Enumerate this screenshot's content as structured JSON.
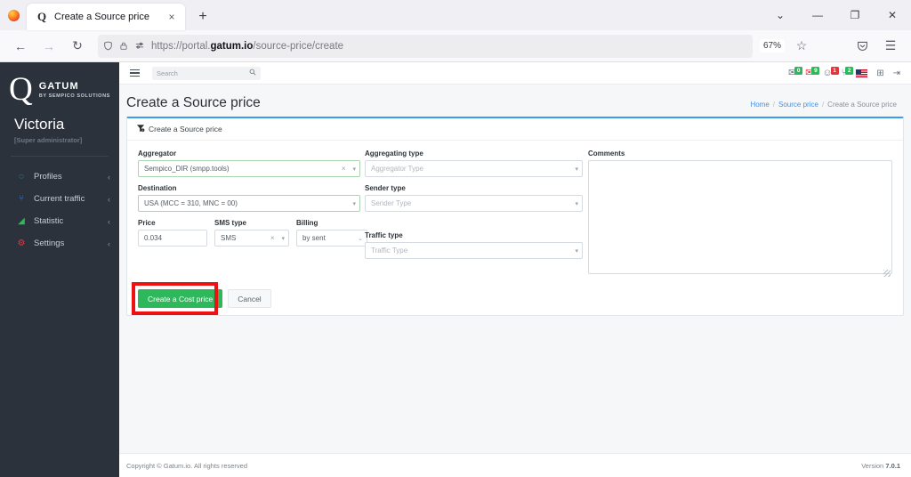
{
  "browser": {
    "tab": {
      "title": "Create a Source price",
      "favicon": "gatum-q-favicon",
      "close_label": "×"
    },
    "new_tab_label": "+",
    "window_controls": {
      "tablist": "⌄",
      "minimize": "—",
      "restore": "❐",
      "close": "✕"
    },
    "nav": {
      "back": "←",
      "forward": "→",
      "reload": "↻"
    },
    "url": {
      "prefix": "https://portal.",
      "domain": "gatum.io",
      "path": "/source-price/create"
    },
    "zoom_level": "67%",
    "bookmark_icon": "☆",
    "pocket_icon": "pocket-icon",
    "app_menu_icon": "☰"
  },
  "sidebar": {
    "brand": {
      "mark": "Q",
      "name": "GATUM",
      "tagline": "BY SEMPICO SOLUTIONS"
    },
    "user": {
      "name": "Victoria",
      "role": "[Super administrator]"
    },
    "items": [
      {
        "label": "Profiles",
        "icon": "profiles-icon",
        "glyph": "◌",
        "color": "#2fb6c8",
        "caret": "‹"
      },
      {
        "label": "Current traffic",
        "icon": "current-traffic-icon",
        "glyph": "⑂",
        "color": "#3a78e7",
        "caret": "‹"
      },
      {
        "label": "Statistic",
        "icon": "statistic-icon",
        "glyph": "◢",
        "color": "#2eb85c",
        "caret": "‹"
      },
      {
        "label": "Settings",
        "icon": "settings-icon",
        "glyph": "⚙",
        "color": "#e5353c",
        "caret": "‹"
      }
    ]
  },
  "topbar": {
    "menu_toggle": "hamburger-icon",
    "search": {
      "value": "",
      "placeholder": "Search",
      "icon": "🔍"
    },
    "icons": [
      {
        "name": "sms-icon",
        "glyph": "✉",
        "badge": "0",
        "badge_color": "green"
      },
      {
        "name": "alerts-icon",
        "glyph": "✉",
        "badge": "9",
        "badge_color": "green"
      },
      {
        "name": "users-icon",
        "glyph": "☺",
        "badge": "1",
        "badge_color": "red"
      },
      {
        "name": "traffic-icon",
        "glyph": "⑂",
        "badge": "2",
        "badge_color": "green"
      }
    ],
    "language_flag": "us-flag-icon",
    "grid_icon": "⊞",
    "logout_icon": "⇥"
  },
  "page": {
    "title": "Create a Source price",
    "breadcrumb": [
      {
        "label": "Home",
        "link": true
      },
      {
        "label": "Source price",
        "link": true
      },
      {
        "label": "Create a Source price",
        "link": false
      }
    ],
    "separator": "/"
  },
  "card": {
    "header": {
      "title": "Create a Source price",
      "icon": "funnel-icon",
      "glyph": "▼"
    },
    "fields": {
      "aggregator": {
        "label": "Aggregator",
        "value": "Sempico_DIR (smpp.tools)",
        "clear": "×",
        "caret": "▾",
        "valid": true
      },
      "destination": {
        "label": "Destination",
        "value": "USA (MCC = 310, MNC = 00)",
        "caret": "▾",
        "valid": true
      },
      "price": {
        "label": "Price",
        "value": "0.034",
        "placeholder": ""
      },
      "sms_type": {
        "label": "SMS type",
        "value": "SMS",
        "clear": "×",
        "caret": "▾"
      },
      "billing": {
        "label": "Billing",
        "value": "by sent",
        "caret": "⌄"
      },
      "aggregating_type": {
        "label": "Aggregating type",
        "value": "",
        "placeholder": "Aggregator Type",
        "caret": "▾"
      },
      "sender_type": {
        "label": "Sender type",
        "value": "",
        "placeholder": "Sender Type",
        "caret": "▾"
      },
      "traffic_type": {
        "label": "Traffic type",
        "value": "",
        "placeholder": "Traffic Type",
        "caret": "▾"
      },
      "comments": {
        "label": "Comments",
        "value": "",
        "placeholder": ""
      }
    },
    "actions": {
      "submit_label": "Create a Cost price",
      "cancel_label": "Cancel",
      "submit_color": "#2eb85c",
      "highlight_color": "#ee1111"
    }
  },
  "footer": {
    "copyright": "Copyright © Gatum.io. All rights reserved",
    "version_label": "Version",
    "version": "7.0.1"
  }
}
